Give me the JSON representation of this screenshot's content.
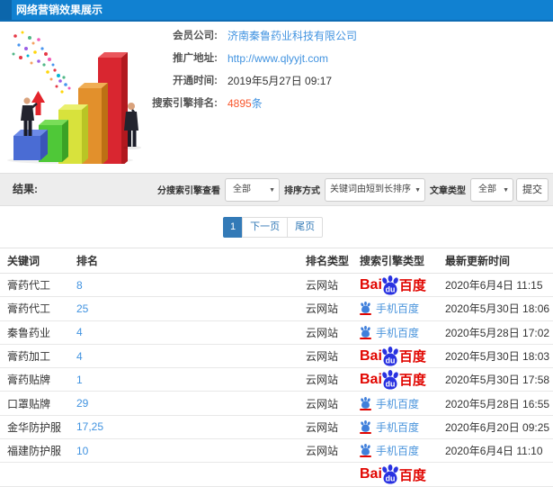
{
  "header": {
    "title": "网络营销效果展示"
  },
  "info": {
    "fields": [
      {
        "label": "会员公司:",
        "value": "济南秦鲁药业科技有限公司",
        "kind": "link"
      },
      {
        "label": "推广地址:",
        "value": "http://www.qlyyjt.com",
        "kind": "link"
      },
      {
        "label": "开通时间:",
        "value": "2019年5月27日 09:17",
        "kind": "text"
      },
      {
        "label": "搜索引擎排名:",
        "value": "4895",
        "suffix": "条",
        "kind": "count"
      }
    ]
  },
  "filters": {
    "result_label": "结果:",
    "engine_label": "分搜索引擎查看",
    "engine_value": "全部",
    "sort_label": "排序方式",
    "sort_value": "关键词由短到长排序",
    "article_label": "文章类型",
    "article_value": "全部",
    "submit_label": "提交"
  },
  "pagination": {
    "current": "1",
    "next": "下一页",
    "last": "尾页"
  },
  "table": {
    "columns": [
      "关键词",
      "排名",
      "排名类型",
      "搜索引擎类型",
      "最新更新时间"
    ],
    "baidu_logo": {
      "latin": "Bai",
      "paw_text": "du",
      "cn": "百度"
    },
    "mobile_label": "手机百度",
    "rows": [
      {
        "keyword": "膏药代工",
        "rank": "8",
        "rank_type": "云网站",
        "engine": "baidu",
        "updated": "2020年6月4日 11:15"
      },
      {
        "keyword": "膏药代工",
        "rank": "25",
        "rank_type": "云网站",
        "engine": "mobile",
        "updated": "2020年5月30日 18:06"
      },
      {
        "keyword": "秦鲁药业",
        "rank": "4",
        "rank_type": "云网站",
        "engine": "mobile",
        "updated": "2020年5月28日 17:02"
      },
      {
        "keyword": "膏药加工",
        "rank": "4",
        "rank_type": "云网站",
        "engine": "baidu",
        "updated": "2020年5月30日 18:03"
      },
      {
        "keyword": "膏药贴牌",
        "rank": "1",
        "rank_type": "云网站",
        "engine": "baidu",
        "updated": "2020年5月30日 17:58"
      },
      {
        "keyword": "口罩贴牌",
        "rank": "29",
        "rank_type": "云网站",
        "engine": "mobile",
        "updated": "2020年5月28日 16:55"
      },
      {
        "keyword": "金华防护服",
        "rank": "17,25",
        "rank_type": "云网站",
        "engine": "mobile",
        "updated": "2020年6月20日 09:25"
      },
      {
        "keyword": "福建防护服",
        "rank": "10",
        "rank_type": "云网站",
        "engine": "mobile",
        "updated": "2020年6月4日 11:10"
      },
      {
        "keyword": "",
        "rank": "",
        "rank_type": "",
        "engine": "baidu",
        "updated": ""
      }
    ]
  }
}
